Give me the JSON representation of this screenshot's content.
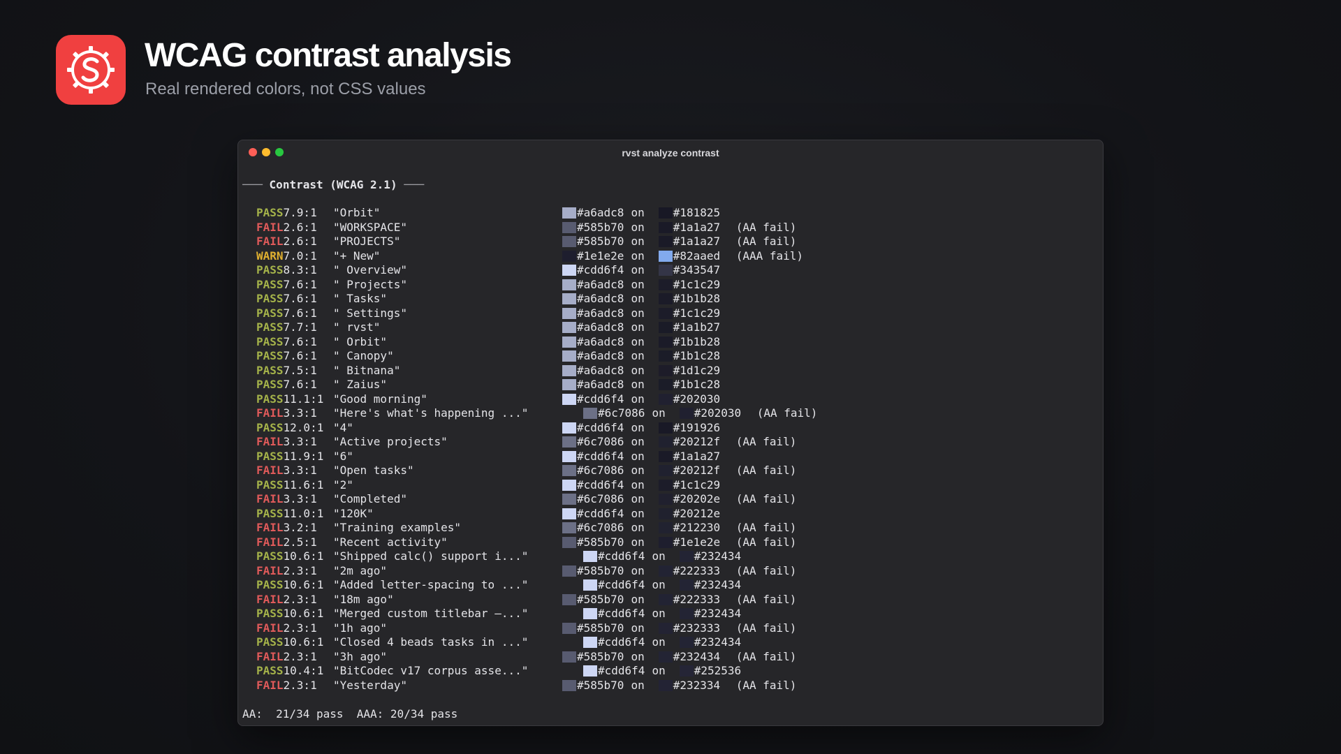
{
  "header": {
    "title": "WCAG contrast analysis",
    "subtitle": "Real rendered colors, not CSS values",
    "icon": "app-logo-icon",
    "accent": "#f04040"
  },
  "window": {
    "title": "rvst analyze contrast",
    "section": "Contrast (WCAG 2.1)",
    "summary": "AA:  21/34 pass  AAA: 20/34 pass"
  },
  "rows": [
    {
      "status": "PASS",
      "ratio": "7.9:1",
      "label": "\"Orbit\"",
      "fg": "#a6adc8",
      "bg": "#181825",
      "note": ""
    },
    {
      "status": "FAIL",
      "ratio": "2.6:1",
      "label": "\"WORKSPACE\"",
      "fg": "#585b70",
      "bg": "#1a1a27",
      "note": "(AA fail)"
    },
    {
      "status": "FAIL",
      "ratio": "2.6:1",
      "label": "\"PROJECTS\"",
      "fg": "#585b70",
      "bg": "#1a1a27",
      "note": "(AA fail)"
    },
    {
      "status": "WARN",
      "ratio": "7.0:1",
      "label": "\"+ New\"",
      "fg": "#1e1e2e",
      "bg": "#82aaed",
      "note": "(AAA fail)"
    },
    {
      "status": "PASS",
      "ratio": "8.3:1",
      "label": "\" Overview\"",
      "fg": "#cdd6f4",
      "bg": "#343547",
      "note": ""
    },
    {
      "status": "PASS",
      "ratio": "7.6:1",
      "label": "\" Projects\"",
      "fg": "#a6adc8",
      "bg": "#1c1c29",
      "note": ""
    },
    {
      "status": "PASS",
      "ratio": "7.6:1",
      "label": "\" Tasks\"",
      "fg": "#a6adc8",
      "bg": "#1b1b28",
      "note": ""
    },
    {
      "status": "PASS",
      "ratio": "7.6:1",
      "label": "\" Settings\"",
      "fg": "#a6adc8",
      "bg": "#1c1c29",
      "note": ""
    },
    {
      "status": "PASS",
      "ratio": "7.7:1",
      "label": "\" rvst\"",
      "fg": "#a6adc8",
      "bg": "#1a1b27",
      "note": ""
    },
    {
      "status": "PASS",
      "ratio": "7.6:1",
      "label": "\" Orbit\"",
      "fg": "#a6adc8",
      "bg": "#1b1b28",
      "note": ""
    },
    {
      "status": "PASS",
      "ratio": "7.6:1",
      "label": "\" Canopy\"",
      "fg": "#a6adc8",
      "bg": "#1b1c28",
      "note": ""
    },
    {
      "status": "PASS",
      "ratio": "7.5:1",
      "label": "\" Bitnana\"",
      "fg": "#a6adc8",
      "bg": "#1d1c29",
      "note": ""
    },
    {
      "status": "PASS",
      "ratio": "7.6:1",
      "label": "\" Zaius\"",
      "fg": "#a6adc8",
      "bg": "#1b1c28",
      "note": ""
    },
    {
      "status": "PASS",
      "ratio": "11.1:1",
      "label": "\"Good morning\"",
      "fg": "#cdd6f4",
      "bg": "#202030",
      "note": ""
    },
    {
      "status": "FAIL",
      "ratio": "3.3:1",
      "label": "\"Here's what's happening ...\"",
      "fg": "#6c7086",
      "bg": "#202030",
      "note": "(AA fail)",
      "shift": true
    },
    {
      "status": "PASS",
      "ratio": "12.0:1",
      "label": "\"4\"",
      "fg": "#cdd6f4",
      "bg": "#191926",
      "note": ""
    },
    {
      "status": "FAIL",
      "ratio": "3.3:1",
      "label": "\"Active projects\"",
      "fg": "#6c7086",
      "bg": "#20212f",
      "note": "(AA fail)"
    },
    {
      "status": "PASS",
      "ratio": "11.9:1",
      "label": "\"6\"",
      "fg": "#cdd6f4",
      "bg": "#1a1a27",
      "note": ""
    },
    {
      "status": "FAIL",
      "ratio": "3.3:1",
      "label": "\"Open tasks\"",
      "fg": "#6c7086",
      "bg": "#20212f",
      "note": "(AA fail)"
    },
    {
      "status": "PASS",
      "ratio": "11.6:1",
      "label": "\"2\"",
      "fg": "#cdd6f4",
      "bg": "#1c1c29",
      "note": ""
    },
    {
      "status": "FAIL",
      "ratio": "3.3:1",
      "label": "\"Completed\"",
      "fg": "#6c7086",
      "bg": "#20202e",
      "note": "(AA fail)"
    },
    {
      "status": "PASS",
      "ratio": "11.0:1",
      "label": "\"120K\"",
      "fg": "#cdd6f4",
      "bg": "#20212e",
      "note": ""
    },
    {
      "status": "FAIL",
      "ratio": "3.2:1",
      "label": "\"Training examples\"",
      "fg": "#6c7086",
      "bg": "#212230",
      "note": "(AA fail)"
    },
    {
      "status": "FAIL",
      "ratio": "2.5:1",
      "label": "\"Recent activity\"",
      "fg": "#585b70",
      "bg": "#1e1e2e",
      "note": "(AA fail)"
    },
    {
      "status": "PASS",
      "ratio": "10.6:1",
      "label": "\"Shipped calc() support i...\"",
      "fg": "#cdd6f4",
      "bg": "#232434",
      "note": "",
      "shift": true
    },
    {
      "status": "FAIL",
      "ratio": "2.3:1",
      "label": "\"2m ago\"",
      "fg": "#585b70",
      "bg": "#222333",
      "note": "(AA fail)"
    },
    {
      "status": "PASS",
      "ratio": "10.6:1",
      "label": "\"Added letter-spacing to ...\"",
      "fg": "#cdd6f4",
      "bg": "#232434",
      "note": "",
      "shift": true
    },
    {
      "status": "FAIL",
      "ratio": "2.3:1",
      "label": "\"18m ago\"",
      "fg": "#585b70",
      "bg": "#222333",
      "note": "(AA fail)"
    },
    {
      "status": "PASS",
      "ratio": "10.6:1",
      "label": "\"Merged custom titlebar —...\"",
      "fg": "#cdd6f4",
      "bg": "#232434",
      "note": "",
      "shift": true
    },
    {
      "status": "FAIL",
      "ratio": "2.3:1",
      "label": "\"1h ago\"",
      "fg": "#585b70",
      "bg": "#232333",
      "note": "(AA fail)"
    },
    {
      "status": "PASS",
      "ratio": "10.6:1",
      "label": "\"Closed 4 beads tasks in ...\"",
      "fg": "#cdd6f4",
      "bg": "#232434",
      "note": "",
      "shift": true
    },
    {
      "status": "FAIL",
      "ratio": "2.3:1",
      "label": "\"3h ago\"",
      "fg": "#585b70",
      "bg": "#232434",
      "note": "(AA fail)"
    },
    {
      "status": "PASS",
      "ratio": "10.4:1",
      "label": "\"BitCodec v17 corpus asse...\"",
      "fg": "#cdd6f4",
      "bg": "#252536",
      "note": "",
      "shift": true
    },
    {
      "status": "FAIL",
      "ratio": "2.3:1",
      "label": "\"Yesterday\"",
      "fg": "#585b70",
      "bg": "#232334",
      "note": "(AA fail)"
    }
  ],
  "on_word": "on"
}
